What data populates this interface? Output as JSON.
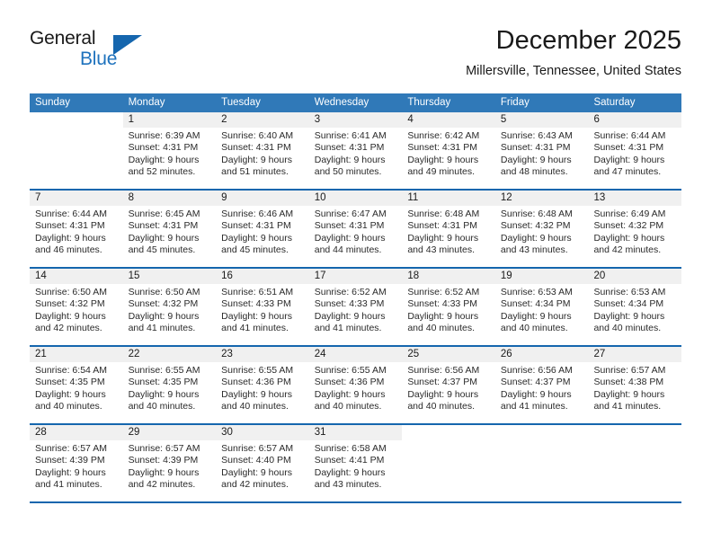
{
  "logo": {
    "word1": "General",
    "word2": "Blue",
    "triangle_color": "#1566ae",
    "blue_color": "#1e72bd"
  },
  "header": {
    "title": "December 2025",
    "subtitle": "Millersville, Tennessee, United States"
  },
  "calendar": {
    "header_bg": "#3079b8",
    "separator_color": "#1566ae",
    "daynum_band_bg": "#f0f0f0",
    "weekdays": [
      "Sunday",
      "Monday",
      "Tuesday",
      "Wednesday",
      "Thursday",
      "Friday",
      "Saturday"
    ],
    "weeks": [
      [
        {
          "day": "",
          "sunrise": "",
          "sunset": "",
          "daylight": ""
        },
        {
          "day": "1",
          "sunrise": "Sunrise: 6:39 AM",
          "sunset": "Sunset: 4:31 PM",
          "daylight": "Daylight: 9 hours and 52 minutes."
        },
        {
          "day": "2",
          "sunrise": "Sunrise: 6:40 AM",
          "sunset": "Sunset: 4:31 PM",
          "daylight": "Daylight: 9 hours and 51 minutes."
        },
        {
          "day": "3",
          "sunrise": "Sunrise: 6:41 AM",
          "sunset": "Sunset: 4:31 PM",
          "daylight": "Daylight: 9 hours and 50 minutes."
        },
        {
          "day": "4",
          "sunrise": "Sunrise: 6:42 AM",
          "sunset": "Sunset: 4:31 PM",
          "daylight": "Daylight: 9 hours and 49 minutes."
        },
        {
          "day": "5",
          "sunrise": "Sunrise: 6:43 AM",
          "sunset": "Sunset: 4:31 PM",
          "daylight": "Daylight: 9 hours and 48 minutes."
        },
        {
          "day": "6",
          "sunrise": "Sunrise: 6:44 AM",
          "sunset": "Sunset: 4:31 PM",
          "daylight": "Daylight: 9 hours and 47 minutes."
        }
      ],
      [
        {
          "day": "7",
          "sunrise": "Sunrise: 6:44 AM",
          "sunset": "Sunset: 4:31 PM",
          "daylight": "Daylight: 9 hours and 46 minutes."
        },
        {
          "day": "8",
          "sunrise": "Sunrise: 6:45 AM",
          "sunset": "Sunset: 4:31 PM",
          "daylight": "Daylight: 9 hours and 45 minutes."
        },
        {
          "day": "9",
          "sunrise": "Sunrise: 6:46 AM",
          "sunset": "Sunset: 4:31 PM",
          "daylight": "Daylight: 9 hours and 45 minutes."
        },
        {
          "day": "10",
          "sunrise": "Sunrise: 6:47 AM",
          "sunset": "Sunset: 4:31 PM",
          "daylight": "Daylight: 9 hours and 44 minutes."
        },
        {
          "day": "11",
          "sunrise": "Sunrise: 6:48 AM",
          "sunset": "Sunset: 4:31 PM",
          "daylight": "Daylight: 9 hours and 43 minutes."
        },
        {
          "day": "12",
          "sunrise": "Sunrise: 6:48 AM",
          "sunset": "Sunset: 4:32 PM",
          "daylight": "Daylight: 9 hours and 43 minutes."
        },
        {
          "day": "13",
          "sunrise": "Sunrise: 6:49 AM",
          "sunset": "Sunset: 4:32 PM",
          "daylight": "Daylight: 9 hours and 42 minutes."
        }
      ],
      [
        {
          "day": "14",
          "sunrise": "Sunrise: 6:50 AM",
          "sunset": "Sunset: 4:32 PM",
          "daylight": "Daylight: 9 hours and 42 minutes."
        },
        {
          "day": "15",
          "sunrise": "Sunrise: 6:50 AM",
          "sunset": "Sunset: 4:32 PM",
          "daylight": "Daylight: 9 hours and 41 minutes."
        },
        {
          "day": "16",
          "sunrise": "Sunrise: 6:51 AM",
          "sunset": "Sunset: 4:33 PM",
          "daylight": "Daylight: 9 hours and 41 minutes."
        },
        {
          "day": "17",
          "sunrise": "Sunrise: 6:52 AM",
          "sunset": "Sunset: 4:33 PM",
          "daylight": "Daylight: 9 hours and 41 minutes."
        },
        {
          "day": "18",
          "sunrise": "Sunrise: 6:52 AM",
          "sunset": "Sunset: 4:33 PM",
          "daylight": "Daylight: 9 hours and 40 minutes."
        },
        {
          "day": "19",
          "sunrise": "Sunrise: 6:53 AM",
          "sunset": "Sunset: 4:34 PM",
          "daylight": "Daylight: 9 hours and 40 minutes."
        },
        {
          "day": "20",
          "sunrise": "Sunrise: 6:53 AM",
          "sunset": "Sunset: 4:34 PM",
          "daylight": "Daylight: 9 hours and 40 minutes."
        }
      ],
      [
        {
          "day": "21",
          "sunrise": "Sunrise: 6:54 AM",
          "sunset": "Sunset: 4:35 PM",
          "daylight": "Daylight: 9 hours and 40 minutes."
        },
        {
          "day": "22",
          "sunrise": "Sunrise: 6:55 AM",
          "sunset": "Sunset: 4:35 PM",
          "daylight": "Daylight: 9 hours and 40 minutes."
        },
        {
          "day": "23",
          "sunrise": "Sunrise: 6:55 AM",
          "sunset": "Sunset: 4:36 PM",
          "daylight": "Daylight: 9 hours and 40 minutes."
        },
        {
          "day": "24",
          "sunrise": "Sunrise: 6:55 AM",
          "sunset": "Sunset: 4:36 PM",
          "daylight": "Daylight: 9 hours and 40 minutes."
        },
        {
          "day": "25",
          "sunrise": "Sunrise: 6:56 AM",
          "sunset": "Sunset: 4:37 PM",
          "daylight": "Daylight: 9 hours and 40 minutes."
        },
        {
          "day": "26",
          "sunrise": "Sunrise: 6:56 AM",
          "sunset": "Sunset: 4:37 PM",
          "daylight": "Daylight: 9 hours and 41 minutes."
        },
        {
          "day": "27",
          "sunrise": "Sunrise: 6:57 AM",
          "sunset": "Sunset: 4:38 PM",
          "daylight": "Daylight: 9 hours and 41 minutes."
        }
      ],
      [
        {
          "day": "28",
          "sunrise": "Sunrise: 6:57 AM",
          "sunset": "Sunset: 4:39 PM",
          "daylight": "Daylight: 9 hours and 41 minutes."
        },
        {
          "day": "29",
          "sunrise": "Sunrise: 6:57 AM",
          "sunset": "Sunset: 4:39 PM",
          "daylight": "Daylight: 9 hours and 42 minutes."
        },
        {
          "day": "30",
          "sunrise": "Sunrise: 6:57 AM",
          "sunset": "Sunset: 4:40 PM",
          "daylight": "Daylight: 9 hours and 42 minutes."
        },
        {
          "day": "31",
          "sunrise": "Sunrise: 6:58 AM",
          "sunset": "Sunset: 4:41 PM",
          "daylight": "Daylight: 9 hours and 43 minutes."
        },
        {
          "day": "",
          "sunrise": "",
          "sunset": "",
          "daylight": ""
        },
        {
          "day": "",
          "sunrise": "",
          "sunset": "",
          "daylight": ""
        },
        {
          "day": "",
          "sunrise": "",
          "sunset": "",
          "daylight": ""
        }
      ]
    ]
  }
}
